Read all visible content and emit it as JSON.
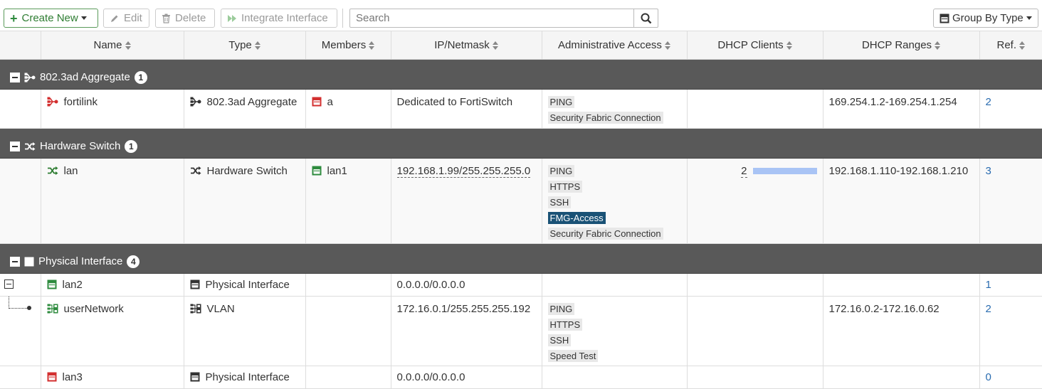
{
  "toolbar": {
    "create_new": "Create New",
    "edit": "Edit",
    "delete": "Delete",
    "integrate": "Integrate Interface",
    "search_placeholder": "Search",
    "group_by": "Group By Type"
  },
  "columns": [
    "Name",
    "Type",
    "Members",
    "IP/Netmask",
    "Administrative Access",
    "DHCP Clients",
    "DHCP Ranges",
    "Ref."
  ],
  "groups": [
    {
      "label": "802.3ad Aggregate",
      "count": "1",
      "icon": "aggregate-icon",
      "rows": [
        {
          "name": "fortilink",
          "name_icon": "aggregate-icon",
          "name_icon_color": "#d32f2f",
          "type": "802.3ad Aggregate",
          "type_icon": "aggregate-icon",
          "members": "a",
          "member_icon_color": "#d32f2f",
          "ip": "Dedicated to FortiSwitch",
          "access": [
            "PING",
            "Security Fabric Connection"
          ],
          "dhcp_clients": "",
          "dhcp_ranges": "169.254.1.2-169.254.1.254",
          "ref": "2"
        }
      ]
    },
    {
      "label": "Hardware Switch",
      "count": "1",
      "icon": "switch-icon",
      "rows": [
        {
          "name": "lan",
          "name_icon": "switch-icon",
          "name_icon_color": "#2e7d32",
          "type": "Hardware Switch",
          "type_icon": "switch-icon",
          "members": "lan1",
          "member_icon_color": "#2e8b3e",
          "ip": "192.168.1.99/255.255.255.0",
          "access": [
            "PING",
            "HTTPS",
            "SSH",
            "FMG-Access",
            "Security Fabric Connection"
          ],
          "access_highlight": "FMG-Access",
          "dhcp_clients": "2",
          "dhcp_ranges": "192.168.1.110-192.168.1.210",
          "ref": "3"
        }
      ]
    },
    {
      "label": "Physical Interface",
      "count": "4",
      "icon": "port-icon",
      "rows": [
        {
          "name": "lan2",
          "name_icon": "port-icon",
          "name_icon_color": "#2e8b3e",
          "type": "Physical Interface",
          "type_icon": "port-icon",
          "ip": "0.0.0.0/0.0.0.0",
          "access": [],
          "dhcp_ranges": "",
          "ref": "1"
        },
        {
          "name": "userNetwork",
          "name_icon": "vlan-icon",
          "name_icon_color": "#2e8b3e",
          "type": "VLAN",
          "type_icon": "vlan-icon",
          "ip": "172.16.0.1/255.255.255.192",
          "access": [
            "PING",
            "HTTPS",
            "SSH",
            "Speed Test"
          ],
          "dhcp_ranges": "172.16.0.2-172.16.0.62",
          "ref": "2"
        },
        {
          "name": "lan3",
          "name_icon": "port-icon",
          "name_icon_color": "#d32f2f",
          "type": "Physical Interface",
          "type_icon": "port-icon",
          "ip": "0.0.0.0/0.0.0.0",
          "access": [],
          "dhcp_ranges": "",
          "ref": "0"
        }
      ]
    }
  ]
}
